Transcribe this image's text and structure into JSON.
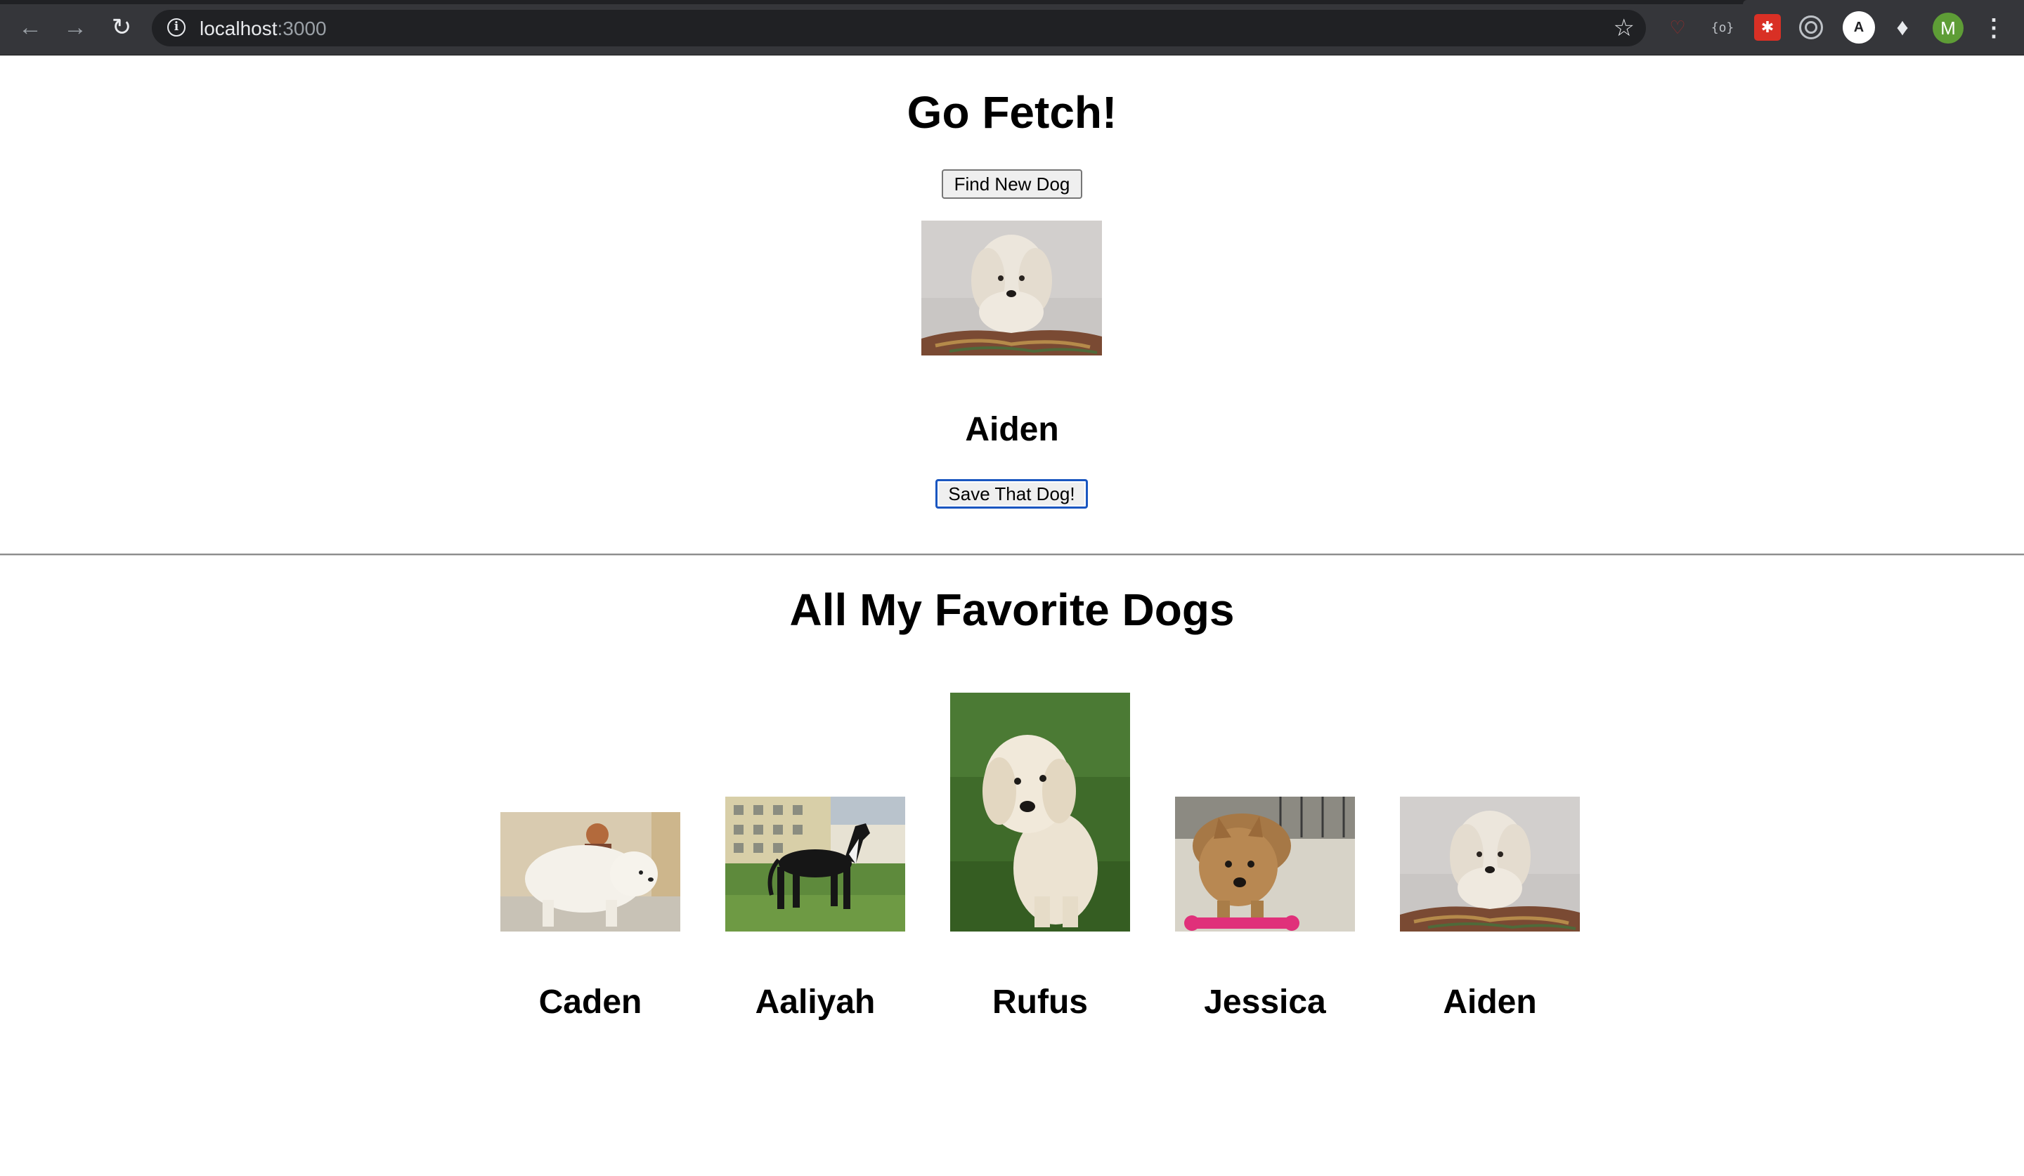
{
  "browser": {
    "url_host": "localhost",
    "url_port": ":3000",
    "profile_initial": "M",
    "extensions": [
      "pocket-icon",
      "json-icon",
      "bug-icon",
      "target-icon",
      "a-icon",
      "puzzle-icon"
    ]
  },
  "app": {
    "title": "Go Fetch!",
    "find_button": "Find New Dog",
    "current_dog": {
      "name": "Aiden",
      "photo": "fluffy-white-dog-on-blanket"
    },
    "save_button": "Save That Dog!",
    "favorites_title": "All My Favorite Dogs",
    "favorites": [
      {
        "name": "Caden",
        "photo": "white-pyrenees-with-person"
      },
      {
        "name": "Aaliyah",
        "photo": "black-great-dane-on-grass"
      },
      {
        "name": "Rufus",
        "photo": "cream-doodle-on-grass"
      },
      {
        "name": "Jessica",
        "photo": "tan-terrier-with-pink-toy"
      },
      {
        "name": "Aiden",
        "photo": "fluffy-white-dog-on-blanket"
      }
    ]
  }
}
